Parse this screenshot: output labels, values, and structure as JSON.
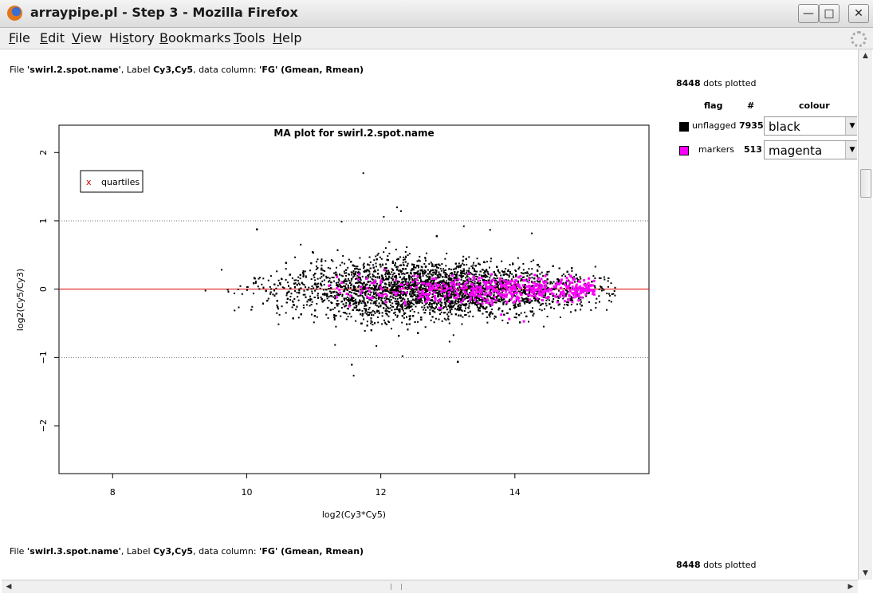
{
  "window": {
    "title": "arraypipe.pl - Step 3 - Mozilla Firefox",
    "minimize_glyph": "—",
    "maximize_glyph": "□",
    "close_glyph": "✕",
    "icon": "firefox-icon"
  },
  "menu": {
    "items": [
      {
        "first": "F",
        "rest": "ile"
      },
      {
        "first": "E",
        "rest": "dit"
      },
      {
        "first": "V",
        "rest": "iew"
      },
      {
        "first": "",
        "rest": "History",
        "ul": "s",
        "pre": "Hi",
        "post": "tory"
      },
      {
        "first": "B",
        "rest": "ookmarks"
      },
      {
        "first": "T",
        "rest": "ools"
      },
      {
        "first": "H",
        "rest": "elp"
      }
    ]
  },
  "section1": {
    "file_prefix": "File ",
    "file_name": "'swirl.2.spot.name'",
    "label_prefix": ", Label ",
    "label": "Cy3,Cy5",
    "column_prefix": ", data column: ",
    "column": "'FG' (Gmean, Rmean)",
    "dots_count": "8448",
    "dots_suffix": " dots plotted"
  },
  "legend_table": {
    "headers": {
      "flag": "flag",
      "count": "#",
      "colour": "colour"
    },
    "rows": [
      {
        "flag": "unflagged",
        "count": "7935",
        "colour": "black",
        "swatch": "#000000"
      },
      {
        "flag": "markers",
        "count": "513",
        "colour": "magenta",
        "swatch": "#ff00ff"
      }
    ]
  },
  "chart_data": {
    "type": "scatter",
    "title": "MA plot for swirl.2.spot.name",
    "xlabel": "log2(Cy3*Cy5)",
    "ylabel": "log2(Cy5/Cy3)",
    "xlim": [
      7.2,
      16.0
    ],
    "ylim": [
      -2.7,
      2.4
    ],
    "x_ticks": [
      8,
      10,
      12,
      14
    ],
    "y_ticks": [
      -2,
      -1,
      0,
      1,
      2
    ],
    "reference_lines": [
      {
        "y": 1,
        "style": "dotted"
      },
      {
        "y": -1,
        "style": "dotted"
      },
      {
        "y": 0,
        "style": "solid",
        "color": "#e00000"
      }
    ],
    "legend": {
      "marker": "x",
      "label": "quartiles",
      "color": "#cc0000",
      "position": "top-left"
    },
    "series": [
      {
        "name": "unflagged",
        "color": "#000000",
        "count": 7935,
        "x_range": [
          7.7,
          15.5
        ],
        "center_x": 12.8,
        "spread_y": 0.35
      },
      {
        "name": "markers",
        "color": "#ff00ff",
        "count": 513,
        "x_range": [
          7.7,
          15.2
        ],
        "center_x": 13.8,
        "spread_y": 0.18
      }
    ]
  },
  "section2": {
    "file_prefix": "File ",
    "file_name": "'swirl.3.spot.name'",
    "label_prefix": ", Label ",
    "label": "Cy3,Cy5",
    "column_prefix": ", data column: ",
    "column": "'FG' (Gmean, Rmean)",
    "dots_count": "8448",
    "dots_suffix": " dots plotted"
  },
  "scrollbar": {
    "up": "▲",
    "down": "▼",
    "left": "◀",
    "right": "▶"
  }
}
